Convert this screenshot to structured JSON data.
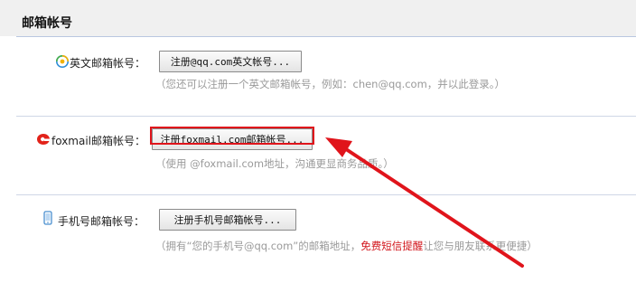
{
  "section": {
    "title": "邮箱帐号"
  },
  "rows": [
    {
      "label": "英文邮箱帐号：",
      "icon": "qq-logo-icon",
      "button_label": "注册@qq.com英文帐号...",
      "hint": "（您还可以注册一个英文邮箱帐号，例如：chen@qq.com，并以此登录。）"
    },
    {
      "label": "foxmail邮箱帐号：",
      "icon": "foxmail-logo-icon",
      "button_label": "注册foxmail.com邮箱帐号...",
      "hint": "（使用 @foxmail.com地址，沟通更显商务品质。）"
    },
    {
      "label": "手机号邮箱帐号：",
      "icon": "mobile-phone-icon",
      "button_label": "注册手机号邮箱帐号...",
      "hint_prefix": "（拥有“您的手机号@qq.com”的邮箱地址，",
      "hint_highlight": "免费短信提醒",
      "hint_suffix": "让您与朋友联系更便捷）"
    }
  ],
  "annotation": {
    "color": "#e0141b",
    "target": "foxmail-register-button"
  }
}
